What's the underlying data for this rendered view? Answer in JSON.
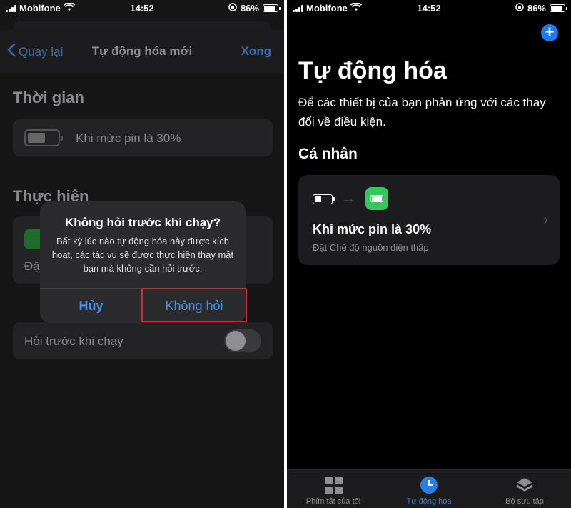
{
  "left": {
    "status": {
      "carrier": "Mobifone",
      "time": "14:52",
      "battery": "86%"
    },
    "nav": {
      "back_label": "Quay lại",
      "title": "Tự động hóa mới",
      "done_label": "Xong"
    },
    "when_section": {
      "title": "Thời gian",
      "trigger_label": "Khi mức pin là 30%"
    },
    "do_section": {
      "title": "Thực hiện",
      "action_prefix": "Đặ"
    },
    "ask_row": {
      "label": "Hỏi trước khi chạy",
      "toggle_on": false
    },
    "alert": {
      "title": "Không hỏi trước khi chạy?",
      "message": "Bất kỳ lúc nào tự động hóa này được kích hoạt, các tác vụ sẽ được thực hiện thay mặt bạn mà không cần hỏi trước.",
      "cancel_label": "Hủy",
      "confirm_label": "Không hỏi"
    },
    "highlight_color": "#e0262a"
  },
  "right": {
    "status": {
      "carrier": "Mobifone",
      "time": "14:52",
      "battery": "86%"
    },
    "title": "Tự động hóa",
    "subtitle": "Để các thiết bị của bạn phản ứng với các thay đổi về điều kiện.",
    "section": "Cá nhân",
    "automation": {
      "title": "Khi mức pin là 30%",
      "subtitle": "Đặt Chế độ nguồn điện thấp"
    },
    "tabs": [
      {
        "label": "Phím tắt của tôi",
        "icon": "grid-icon",
        "active": false
      },
      {
        "label": "Tự động hóa",
        "icon": "clock-icon",
        "active": true
      },
      {
        "label": "Bộ sưu tập",
        "icon": "layers-icon",
        "active": false
      }
    ],
    "accent_color": "#2b7de9"
  }
}
